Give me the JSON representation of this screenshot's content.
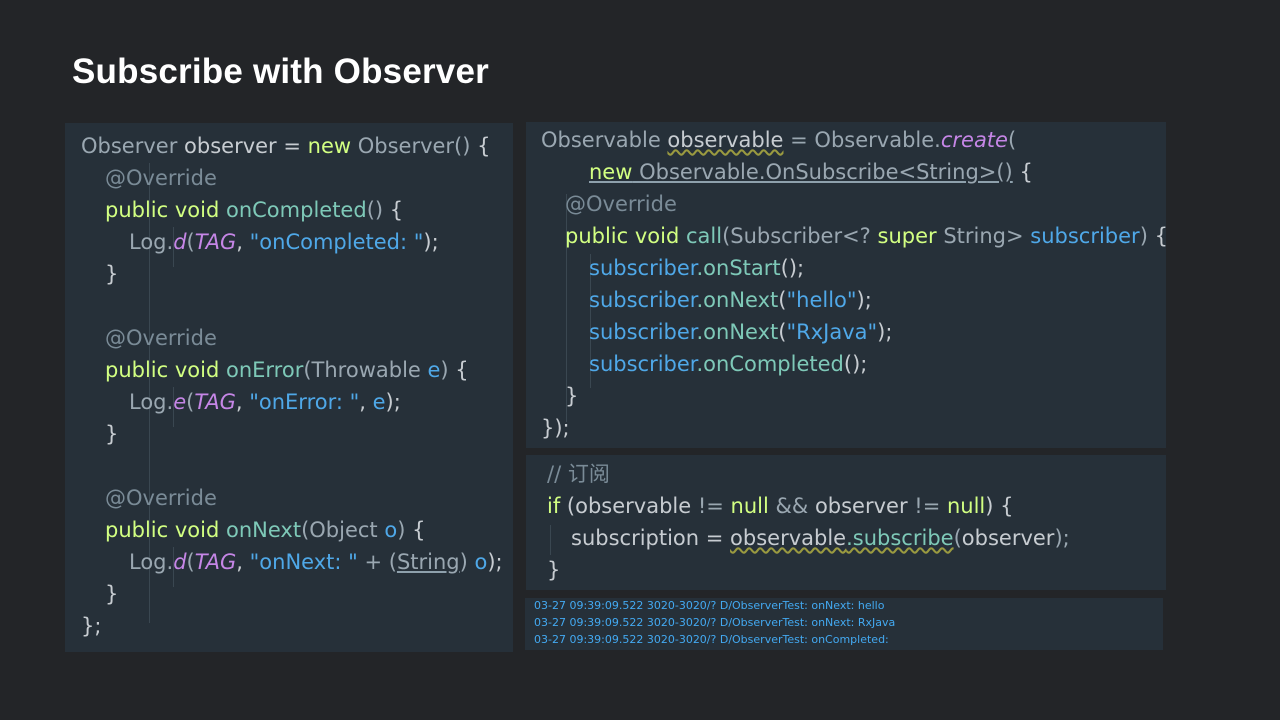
{
  "slide": {
    "title": "Subscribe with Observer"
  },
  "observer_code": {
    "l1": {
      "t1": "Observer",
      "v1": "observer",
      "op": " = ",
      "kw": "new",
      "t2": " Observer()",
      "br": " {"
    },
    "l2": {
      "ann": "@Override"
    },
    "l3": {
      "kw": "public void ",
      "fn": "onCompleted",
      "p": "()",
      "br": " {"
    },
    "l4": {
      "cls": "Log.",
      "m": "d",
      "p1": "(",
      "tag": "TAG",
      "c": ", ",
      "s": "\"onCompleted: \"",
      "p2": ");"
    },
    "l5": {
      "br": "}"
    },
    "l7": {
      "ann": "@Override"
    },
    "l8": {
      "kw": "public void ",
      "fn": "onError",
      "p1": "(Throwable ",
      "v": "e",
      "p2": ")",
      "br": " {"
    },
    "l9": {
      "cls": "Log.",
      "m": "e",
      "p1": "(",
      "tag": "TAG",
      "c": ", ",
      "s": "\"onError: \"",
      "c2": ", ",
      "v": "e",
      "p2": ");"
    },
    "l10": {
      "br": "}"
    },
    "l12": {
      "ann": "@Override"
    },
    "l13": {
      "kw": "public void ",
      "fn": "onNext",
      "p1": "(Object ",
      "v": "o",
      "p2": ")",
      "br": " {"
    },
    "l14": {
      "cls": "Log.",
      "m": "d",
      "p1": "(",
      "tag": "TAG",
      "c": ", ",
      "s": "\"onNext: \"",
      "op": " + (",
      "ty": "String",
      "p2": ") ",
      "v": "o",
      "p3": ");"
    },
    "l15": {
      "br": "}"
    },
    "l16": {
      "br": "};"
    }
  },
  "observable_code": {
    "l1": {
      "t": "Observable ",
      "v": "observable",
      "op": " = Observable.",
      "m": "create",
      "p": "("
    },
    "l2": {
      "kw": "new",
      "t": " Observable.OnSubscribe<String>()",
      "br": " {"
    },
    "l3": {
      "ann": "@Override"
    },
    "l4": {
      "kw": "public void ",
      "fn": "call",
      "p1": "(Subscriber<? ",
      "kw2": "super",
      "p2": " String> ",
      "v": "subscriber",
      "p3": ")",
      "br": " {"
    },
    "l5": {
      "v": "subscriber",
      "fn": ".onStart",
      "p": "();"
    },
    "l6": {
      "v": "subscriber",
      "fn": ".onNext",
      "p1": "(",
      "s": "\"hello\"",
      "p2": ");"
    },
    "l7": {
      "v": "subscriber",
      "fn": ".onNext",
      "p1": "(",
      "s": "\"RxJava\"",
      "p2": ");"
    },
    "l8": {
      "v": "subscriber",
      "fn": ".onCompleted",
      "p": "();"
    },
    "l9": {
      "br": "}"
    },
    "l10": {
      "br": "});"
    }
  },
  "subscribe_code": {
    "l1": {
      "cm": "// 订阅"
    },
    "l2": {
      "kw": "if",
      "p1": " (observable ",
      "op1": "!=",
      "n1": " null",
      "op2": " && ",
      "p2": "observer ",
      "op3": "!=",
      "n2": " null",
      "p3": ") {"
    },
    "l3": {
      "v": "subscription",
      "op": " = ",
      "v2": "observable",
      "fn": ".subscribe",
      "p1": "(",
      "a": "observer",
      "p2": ");"
    },
    "l4": {
      "br": "}"
    }
  },
  "logcat": {
    "lines": [
      "03-27 09:39:09.522 3020-3020/? D/ObserverTest: onNext: hello",
      "03-27 09:39:09.522 3020-3020/? D/ObserverTest: onNext: RxJava",
      "03-27 09:39:09.522 3020-3020/? D/ObserverTest: onCompleted:"
    ]
  },
  "colors": {
    "background": "#232528",
    "panel": "#263039",
    "keyword": "#d2ff82",
    "variable": "#4fa8e8",
    "italic_method": "#c586e6",
    "annotation": "#7a8b97",
    "log_text": "#43a9f1"
  }
}
